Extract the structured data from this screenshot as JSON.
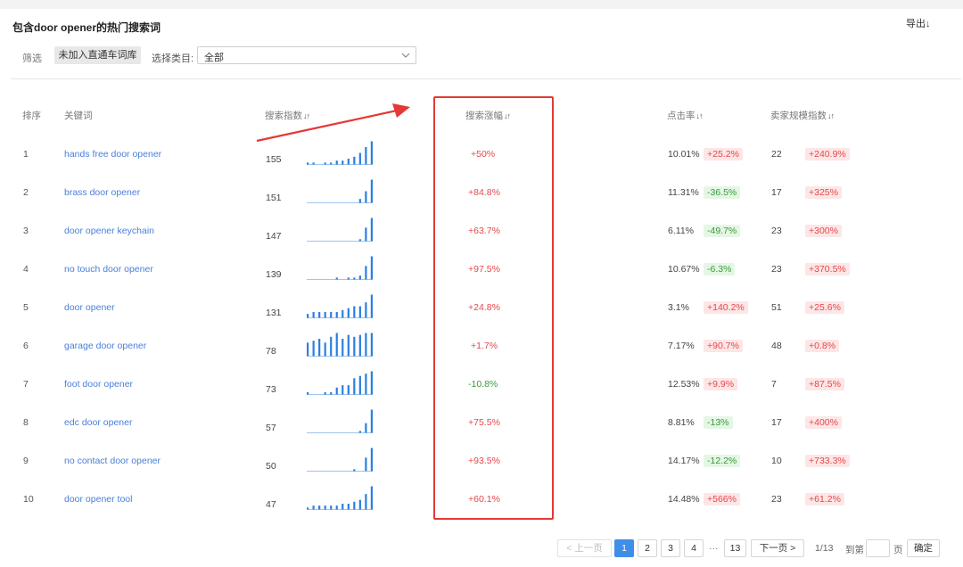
{
  "header": {
    "title": "包含door opener的热门搜索词",
    "export_label": "导出↓"
  },
  "filters": {
    "filter_label": "筛选",
    "chip_label": "未加入直通车词库",
    "category_label": "选择类目:",
    "category_value": "全部"
  },
  "columns": {
    "rank": "排序",
    "keyword": "关键词",
    "search_index": "搜索指数",
    "search_growth": "搜索涨幅",
    "ctr": "点击率",
    "seller_scale": "卖家规模指数",
    "sort_icon": "↓↑"
  },
  "rows": [
    {
      "rank": "1",
      "keyword": "hands free door opener",
      "index": "155",
      "growth": "+50%",
      "growth_dir": "up",
      "ctr": "10.01%",
      "ctr_change": "+25.2%",
      "ctr_dir": "up",
      "seller": "22",
      "seller_change": "+240.9%",
      "seller_dir": "up",
      "spark": [
        1,
        1,
        0,
        1,
        1,
        2,
        2,
        3,
        4,
        6,
        9,
        12
      ]
    },
    {
      "rank": "2",
      "keyword": "brass door opener",
      "index": "151",
      "growth": "+84.8%",
      "growth_dir": "up",
      "ctr": "11.31%",
      "ctr_change": "-36.5%",
      "ctr_dir": "down",
      "seller": "17",
      "seller_change": "+325%",
      "seller_dir": "up",
      "spark": [
        0,
        0,
        0,
        0,
        0,
        0,
        0,
        0,
        0,
        2,
        6,
        12
      ]
    },
    {
      "rank": "3",
      "keyword": "door opener keychain",
      "index": "147",
      "growth": "+63.7%",
      "growth_dir": "up",
      "ctr": "6.11%",
      "ctr_change": "-49.7%",
      "ctr_dir": "down",
      "seller": "23",
      "seller_change": "+300%",
      "seller_dir": "up",
      "spark": [
        0,
        0,
        0,
        0,
        0,
        0,
        0,
        0,
        0,
        1,
        7,
        12
      ]
    },
    {
      "rank": "4",
      "keyword": "no touch door opener",
      "index": "139",
      "growth": "+97.5%",
      "growth_dir": "up",
      "ctr": "10.67%",
      "ctr_change": "-6.3%",
      "ctr_dir": "down",
      "seller": "23",
      "seller_change": "+370.5%",
      "seller_dir": "up",
      "spark": [
        0,
        0,
        0,
        0,
        0,
        1,
        0,
        1,
        1,
        2,
        7,
        12
      ]
    },
    {
      "rank": "5",
      "keyword": "door opener",
      "index": "131",
      "growth": "+24.8%",
      "growth_dir": "up",
      "ctr": "3.1%",
      "ctr_change": "+140.2%",
      "ctr_dir": "up",
      "seller": "51",
      "seller_change": "+25.6%",
      "seller_dir": "up",
      "spark": [
        2,
        3,
        3,
        3,
        3,
        3,
        4,
        5,
        6,
        6,
        8,
        12
      ]
    },
    {
      "rank": "6",
      "keyword": "garage door opener",
      "index": "78",
      "growth": "+1.7%",
      "growth_dir": "up",
      "ctr": "7.17%",
      "ctr_change": "+90.7%",
      "ctr_dir": "up",
      "seller": "48",
      "seller_change": "+0.8%",
      "seller_dir": "up",
      "spark": [
        7,
        8,
        9,
        7,
        10,
        12,
        9,
        11,
        10,
        11,
        12,
        12
      ]
    },
    {
      "rank": "7",
      "keyword": "foot door opener",
      "index": "73",
      "growth": "-10.8%",
      "growth_dir": "down",
      "ctr": "12.53%",
      "ctr_change": "+9.9%",
      "ctr_dir": "up",
      "seller": "7",
      "seller_change": "+87.5%",
      "seller_dir": "up",
      "spark": [
        1,
        0,
        0,
        1,
        1,
        3,
        4,
        4,
        7,
        8,
        9,
        10
      ]
    },
    {
      "rank": "8",
      "keyword": "edc door opener",
      "index": "57",
      "growth": "+75.5%",
      "growth_dir": "up",
      "ctr": "8.81%",
      "ctr_change": "-13%",
      "ctr_dir": "down",
      "seller": "17",
      "seller_change": "+400%",
      "seller_dir": "up",
      "spark": [
        0,
        0,
        0,
        0,
        0,
        0,
        0,
        0,
        0,
        1,
        5,
        12
      ]
    },
    {
      "rank": "9",
      "keyword": "no contact door opener",
      "index": "50",
      "growth": "+93.5%",
      "growth_dir": "up",
      "ctr": "14.17%",
      "ctr_change": "-12.2%",
      "ctr_dir": "down",
      "seller": "10",
      "seller_change": "+733.3%",
      "seller_dir": "up",
      "spark": [
        0,
        0,
        0,
        0,
        0,
        0,
        0,
        0,
        1,
        0,
        7,
        12
      ]
    },
    {
      "rank": "10",
      "keyword": "door opener tool",
      "index": "47",
      "growth": "+60.1%",
      "growth_dir": "up",
      "ctr": "14.48%",
      "ctr_change": "+566%",
      "ctr_dir": "up",
      "seller": "23",
      "seller_change": "+61.2%",
      "seller_dir": "up",
      "spark": [
        1,
        2,
        2,
        2,
        2,
        2,
        3,
        3,
        4,
        5,
        8,
        12
      ]
    }
  ],
  "pagination": {
    "prev_label": "上一页",
    "pages": [
      "1",
      "2",
      "3",
      "4"
    ],
    "ellipsis": "···",
    "last_page": "13",
    "next_label": "下一页",
    "page_info": "1/13",
    "goto_label": "到第",
    "page_unit": "页",
    "confirm_label": "确定",
    "current_page": "1"
  },
  "colors": {
    "accent": "#3f8ee8",
    "highlight": "#e53935",
    "keyword": "#4a7fd9",
    "up": "#e5484d",
    "down": "#3a9b3a"
  }
}
